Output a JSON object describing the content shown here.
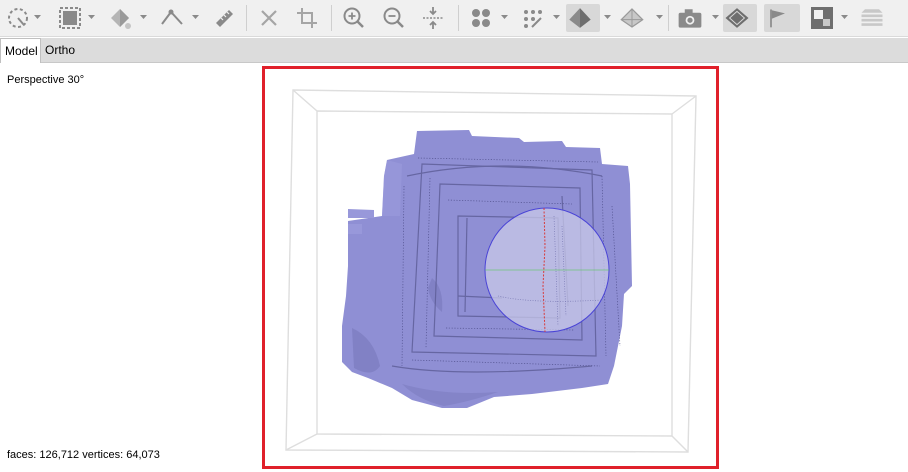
{
  "tabs": [
    {
      "label": "Model",
      "active": true
    },
    {
      "label": "Ortho",
      "active": false
    }
  ],
  "viewport": {
    "projection_label": "Perspective 30°",
    "stats_label": "faces: 126,712 vertices: 64,073"
  },
  "toolbar": {
    "icons": [
      "selection-lasso-icon",
      "select-rectangle-icon",
      "paint-bucket-icon",
      "measure-angle-icon",
      "ruler-icon",
      "delete-icon",
      "crop-icon",
      "zoom-in-icon",
      "zoom-out-icon",
      "fit-view-icon",
      "points-grid-icon",
      "points-sparse-icon",
      "solid-pyramid-icon",
      "wireframe-pyramid-icon",
      "camera-icon",
      "texture-diamond-icon",
      "flag-icon",
      "image-texture-icon",
      "layers-icon"
    ]
  },
  "colors": {
    "mesh": "#8f8fd4",
    "highlight_frame": "#e0202a",
    "sphere_outline": "#4a44d6",
    "toolbar_icon": "#8a8a8a"
  }
}
